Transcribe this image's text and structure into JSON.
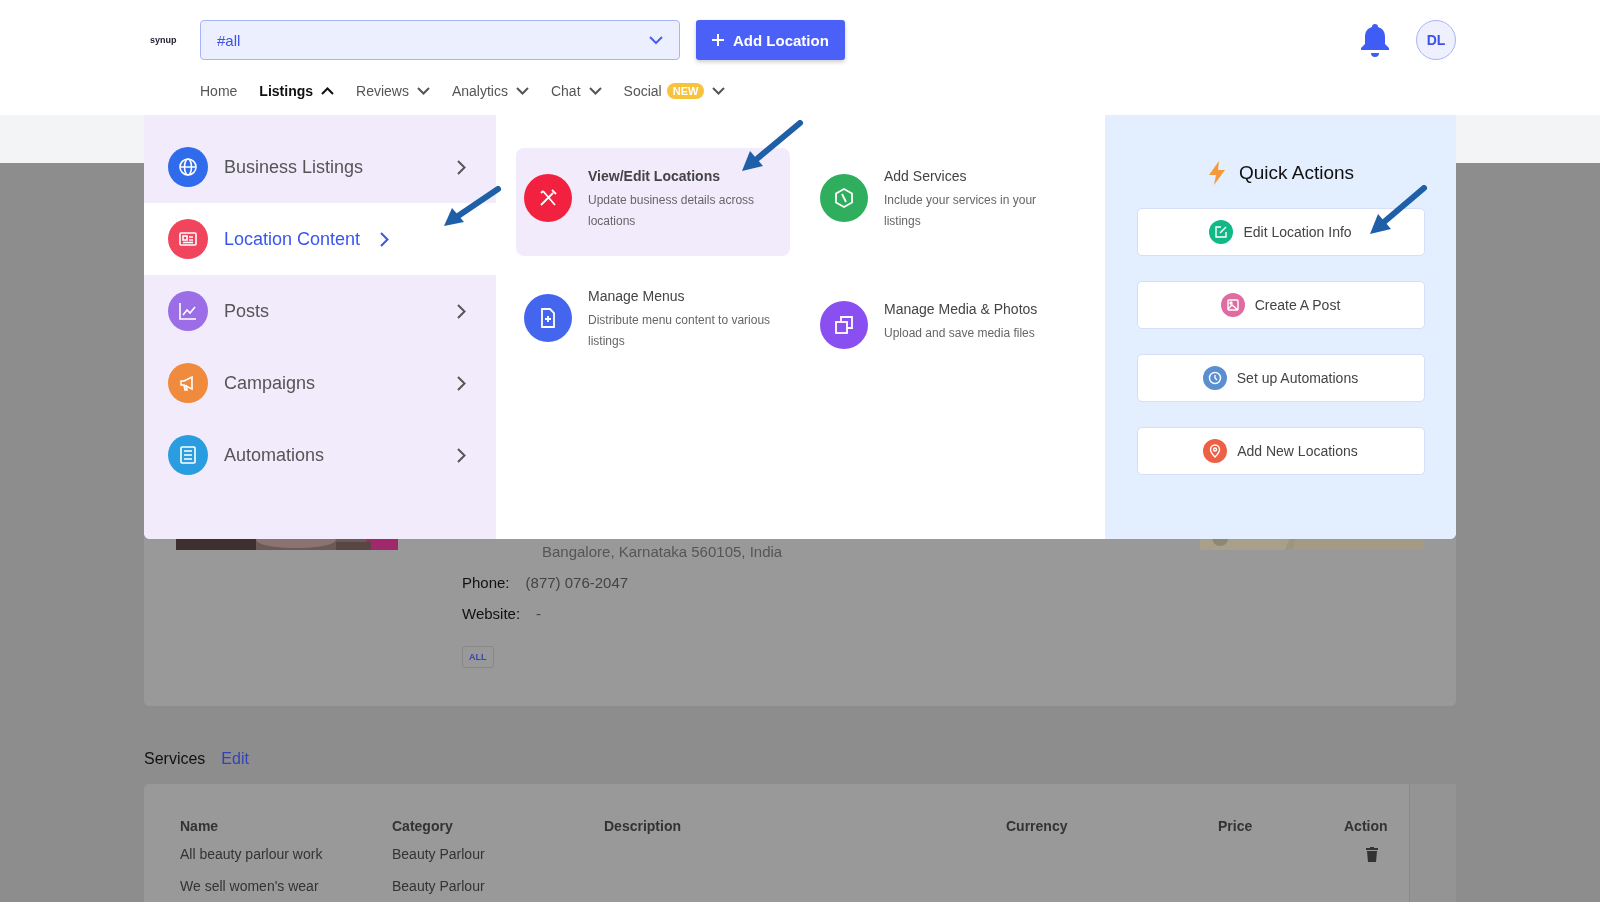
{
  "header": {
    "logo": "synup",
    "location_select": {
      "value": "#all"
    },
    "add_button": "Add Location",
    "avatar": "DL"
  },
  "nav": [
    {
      "label": "Home",
      "selected": false,
      "dropdown": false
    },
    {
      "label": "Listings",
      "selected": true,
      "dropdown": true,
      "expanded": true
    },
    {
      "label": "Reviews",
      "selected": false,
      "dropdown": true,
      "expanded": false
    },
    {
      "label": "Analytics",
      "selected": false,
      "dropdown": true,
      "expanded": false
    },
    {
      "label": "Chat",
      "selected": false,
      "dropdown": true,
      "expanded": false
    },
    {
      "label": "Social",
      "selected": false,
      "dropdown": true,
      "expanded": false,
      "badge": "NEW"
    }
  ],
  "menu": {
    "categories": [
      {
        "label": "Business Listings",
        "selected": false,
        "color": "#2f6bea"
      },
      {
        "label": "Location Content",
        "selected": true,
        "color": "#f0455d"
      },
      {
        "label": "Posts",
        "selected": false,
        "color": "#9b6ee8"
      },
      {
        "label": "Campaigns",
        "selected": false,
        "color": "#f08a3c"
      },
      {
        "label": "Automations",
        "selected": false,
        "color": "#2a9de0"
      }
    ],
    "features": [
      {
        "title": "View/Edit Locations",
        "description": "Update business details across locations",
        "selected": true,
        "color": "#f2213f"
      },
      {
        "title": "Add Services",
        "description": "Include your services in your listings",
        "selected": false,
        "color": "#2fae5e"
      },
      {
        "title": "Manage Menus",
        "description": "Distribute menu content to various listings",
        "selected": false,
        "color": "#4466ee"
      },
      {
        "title": "Manage Media & Photos",
        "description": "Upload and save media files",
        "selected": false,
        "color": "#8a4ff0"
      }
    ],
    "quick_actions": {
      "title": "Quick Actions",
      "items": [
        {
          "label": "Edit Location Info",
          "color": "#12b886"
        },
        {
          "label": "Create A Post",
          "color": "#e06ba0"
        },
        {
          "label": "Set up Automations",
          "color": "#5b8fd0"
        },
        {
          "label": "Add New Locations",
          "color": "#ee6045"
        }
      ]
    }
  },
  "location": {
    "address": "Bangalore, Karnataka 560105, India",
    "phone_label": "Phone:",
    "phone": "(877) 076-2047",
    "website_label": "Website:",
    "website": "-",
    "tag": "ALL"
  },
  "services": {
    "heading": "Services",
    "edit_link": "Edit",
    "columns": [
      "Name",
      "Category",
      "Description",
      "Currency",
      "Price",
      "Action"
    ],
    "rows": [
      {
        "name": "All beauty parlour work",
        "category": "Beauty Parlour"
      },
      {
        "name": "We sell women's wear",
        "category": "Beauty Parlour"
      }
    ]
  }
}
